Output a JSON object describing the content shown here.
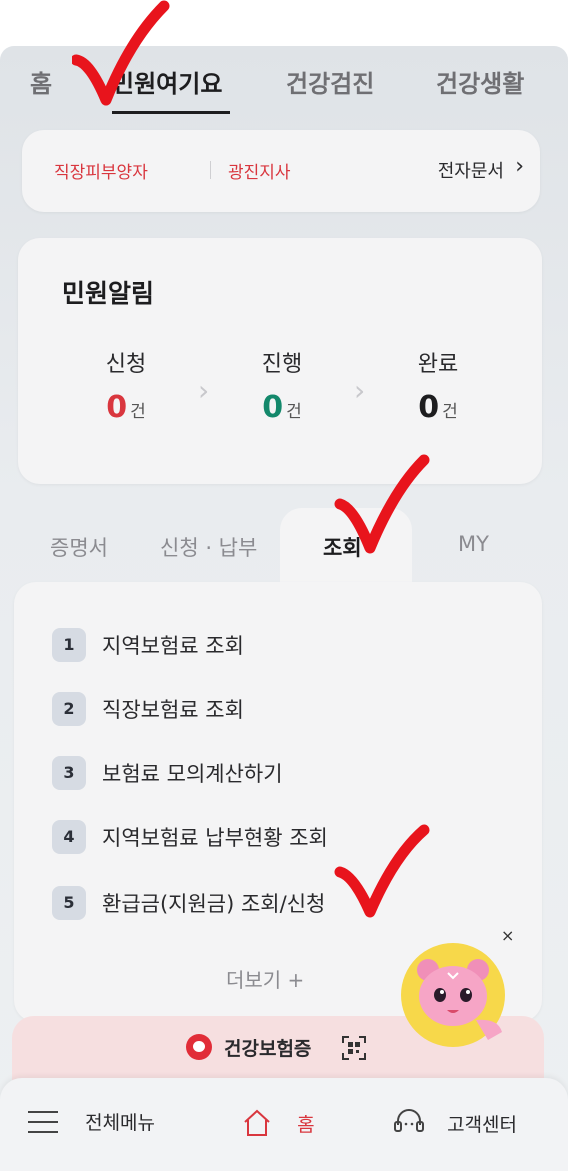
{
  "top_tabs": [
    {
      "label": "홈"
    },
    {
      "label": "민원여기요"
    },
    {
      "label": "건강검진"
    },
    {
      "label": "건강생활"
    }
  ],
  "info_bar": {
    "member_type": "직장피부양자",
    "branch": "광진지사",
    "edoc_label": "전자문서",
    "edoc_chevron": "›"
  },
  "alert": {
    "title": "민원알림",
    "statuses": [
      {
        "label": "신청",
        "count": "0",
        "unit": "건",
        "color": "#d9363e"
      },
      {
        "label": "진행",
        "count": "0",
        "unit": "건",
        "color": "#13886b"
      },
      {
        "label": "완료",
        "count": "0",
        "unit": "건",
        "color": "#1d1d1f"
      }
    ],
    "arrow": "›"
  },
  "mid_tabs": [
    {
      "label": "증명서"
    },
    {
      "label": "신청 · 납부"
    },
    {
      "label": "조회"
    },
    {
      "label": "MY"
    }
  ],
  "list": [
    {
      "num": "1",
      "label": "지역보험료 조회"
    },
    {
      "num": "2",
      "label": "직장보험료 조회"
    },
    {
      "num": "3",
      "label": "보험료 모의계산하기"
    },
    {
      "num": "4",
      "label": "지역보험료 납부현황 조회"
    },
    {
      "num": "5",
      "label": "환급금(지원금) 조회/신청"
    }
  ],
  "more_label": "더보기 +",
  "insurance_card": {
    "label": "건강보험증"
  },
  "close_symbol": "×",
  "bottom_nav": [
    {
      "label": "전체메뉴",
      "icon": "hamburger-icon"
    },
    {
      "label": "홈",
      "icon": "home-icon"
    },
    {
      "label": "고객센터",
      "icon": "headset-icon"
    }
  ],
  "colors": {
    "accent_red": "#d9363e",
    "accent_green": "#13886b",
    "check_red": "#e8141c"
  }
}
